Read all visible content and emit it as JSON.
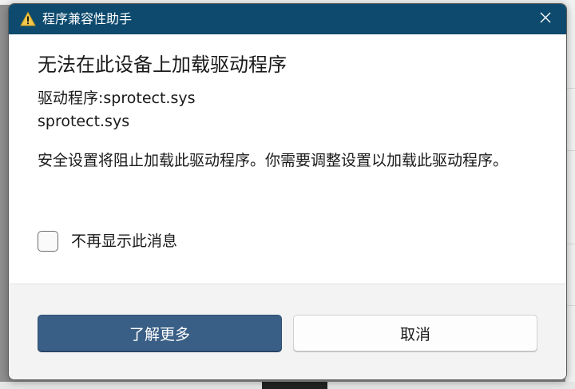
{
  "window": {
    "title": "程序兼容性助手",
    "title_icon": "warning-icon",
    "close_icon": "close-icon"
  },
  "content": {
    "heading": "无法在此设备上加载驱动程序",
    "driver_label_line": "驱动程序:sprotect.sys",
    "driver_file_line": "sprotect.sys",
    "message": "安全设置将阻止加载此驱动程序。你需要调整设置以加载此驱动程序。",
    "checkbox_label": "不再显示此消息",
    "checkbox_checked": false
  },
  "footer": {
    "primary_button": "了解更多",
    "secondary_button": "取消"
  },
  "colors": {
    "titlebar": "#0d4a6e",
    "primary_button": "#3a5f86",
    "warning_yellow": "#f2c94c"
  }
}
